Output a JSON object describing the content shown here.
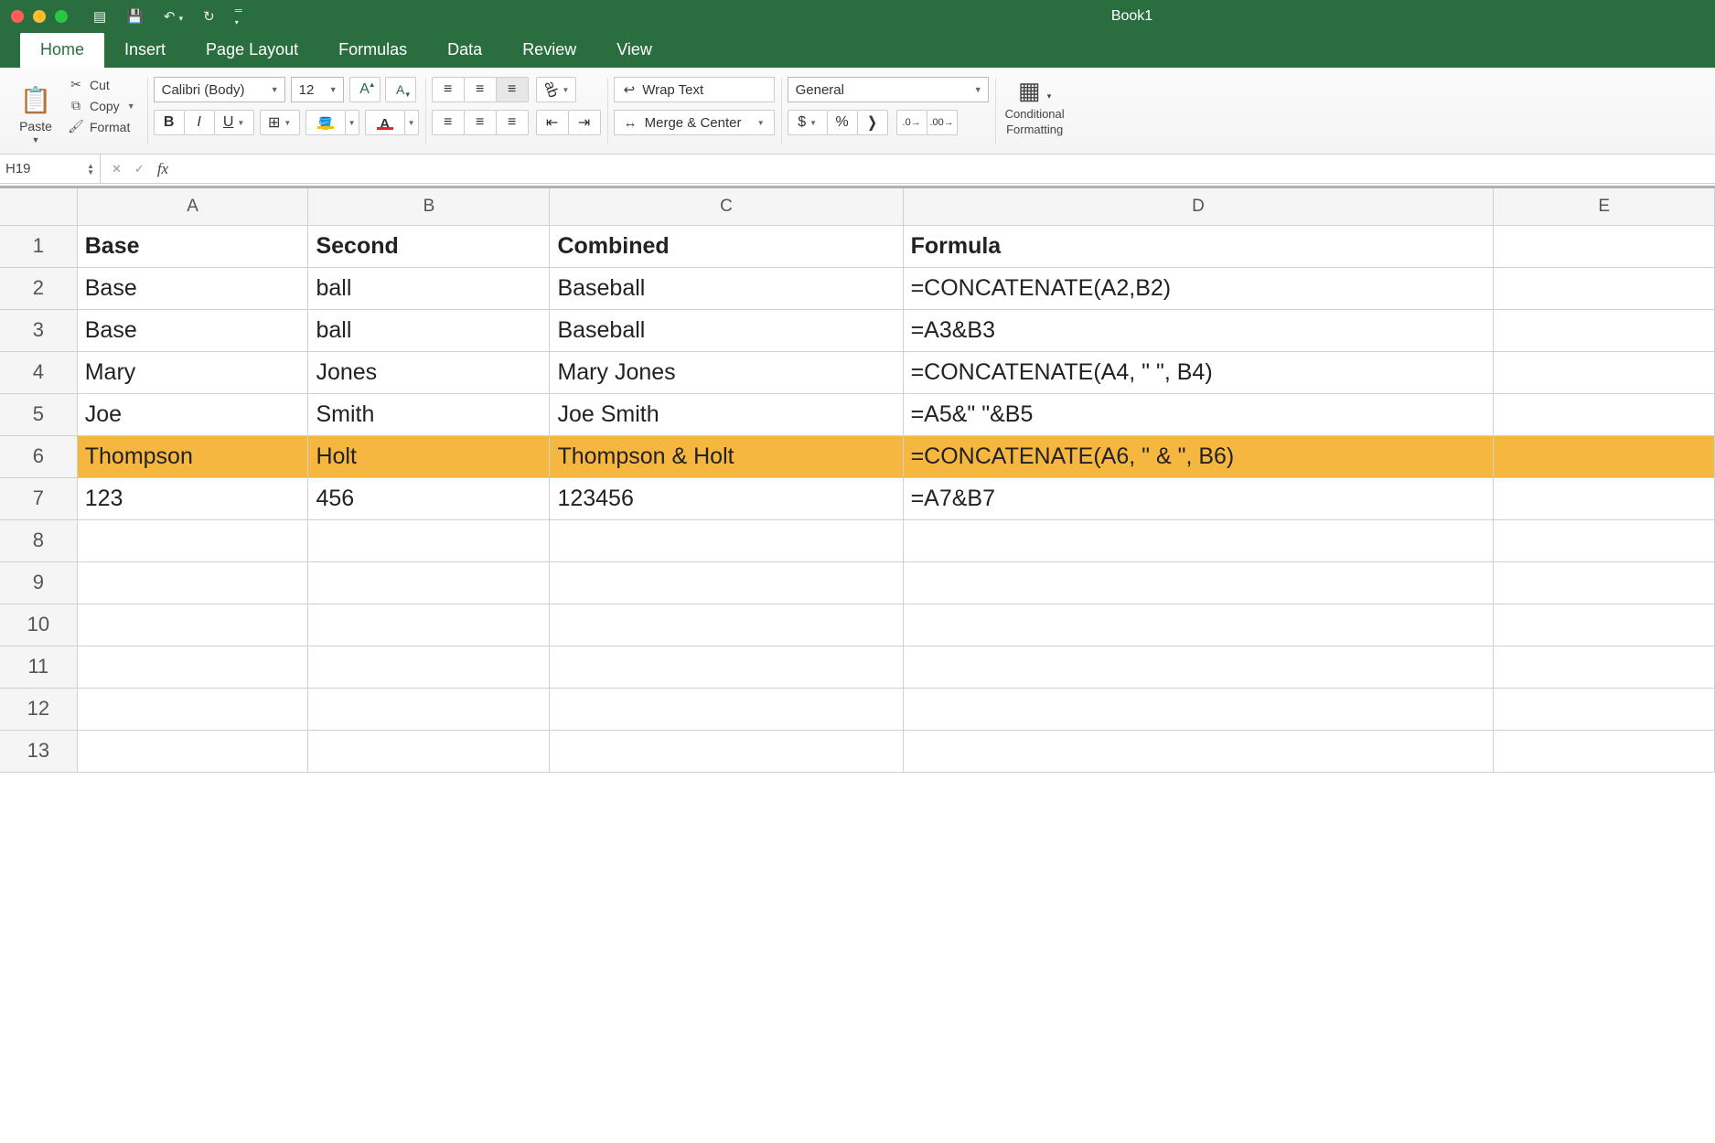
{
  "window": {
    "title": "Book1"
  },
  "tabs": [
    "Home",
    "Insert",
    "Page Layout",
    "Formulas",
    "Data",
    "Review",
    "View"
  ],
  "active_tab": 0,
  "clipboard": {
    "paste": "Paste",
    "cut": "Cut",
    "copy": "Copy",
    "format": "Format"
  },
  "font": {
    "name": "Calibri (Body)",
    "size": "12"
  },
  "number_format": "General",
  "align": {
    "wrap": "Wrap Text",
    "merge": "Merge & Center"
  },
  "cond_fmt": {
    "line1": "Conditional",
    "line2": "Formatting"
  },
  "name_box": "H19",
  "formula_value": "",
  "columns": [
    "A",
    "B",
    "C",
    "D",
    "E"
  ],
  "row_count": 13,
  "highlight_row": 6,
  "rows": [
    {
      "n": 1,
      "bold": true,
      "cells": [
        "Base",
        "Second",
        "Combined",
        "Formula",
        ""
      ]
    },
    {
      "n": 2,
      "bold": false,
      "cells": [
        "Base",
        "ball",
        "Baseball",
        "=CONCATENATE(A2,B2)",
        ""
      ]
    },
    {
      "n": 3,
      "bold": false,
      "cells": [
        "Base",
        "ball",
        "Baseball",
        "=A3&B3",
        ""
      ]
    },
    {
      "n": 4,
      "bold": false,
      "cells": [
        "Mary",
        "Jones",
        "Mary Jones",
        "=CONCATENATE(A4, \" \", B4)",
        ""
      ]
    },
    {
      "n": 5,
      "bold": false,
      "cells": [
        "Joe",
        "Smith",
        "Joe Smith",
        "=A5&\" \"&B5",
        ""
      ]
    },
    {
      "n": 6,
      "bold": false,
      "cells": [
        "Thompson",
        "Holt",
        "Thompson & Holt",
        "=CONCATENATE(A6, \" & \", B6)",
        ""
      ]
    },
    {
      "n": 7,
      "bold": false,
      "cells": [
        "123",
        "456",
        "123456",
        "=A7&B7",
        ""
      ]
    },
    {
      "n": 8,
      "bold": false,
      "cells": [
        "",
        "",
        "",
        "",
        ""
      ]
    },
    {
      "n": 9,
      "bold": false,
      "cells": [
        "",
        "",
        "",
        "",
        ""
      ]
    },
    {
      "n": 10,
      "bold": false,
      "cells": [
        "",
        "",
        "",
        "",
        ""
      ]
    },
    {
      "n": 11,
      "bold": false,
      "cells": [
        "",
        "",
        "",
        "",
        ""
      ]
    },
    {
      "n": 12,
      "bold": false,
      "cells": [
        "",
        "",
        "",
        "",
        ""
      ]
    },
    {
      "n": 13,
      "bold": false,
      "cells": [
        "",
        "",
        "",
        "",
        ""
      ]
    }
  ]
}
